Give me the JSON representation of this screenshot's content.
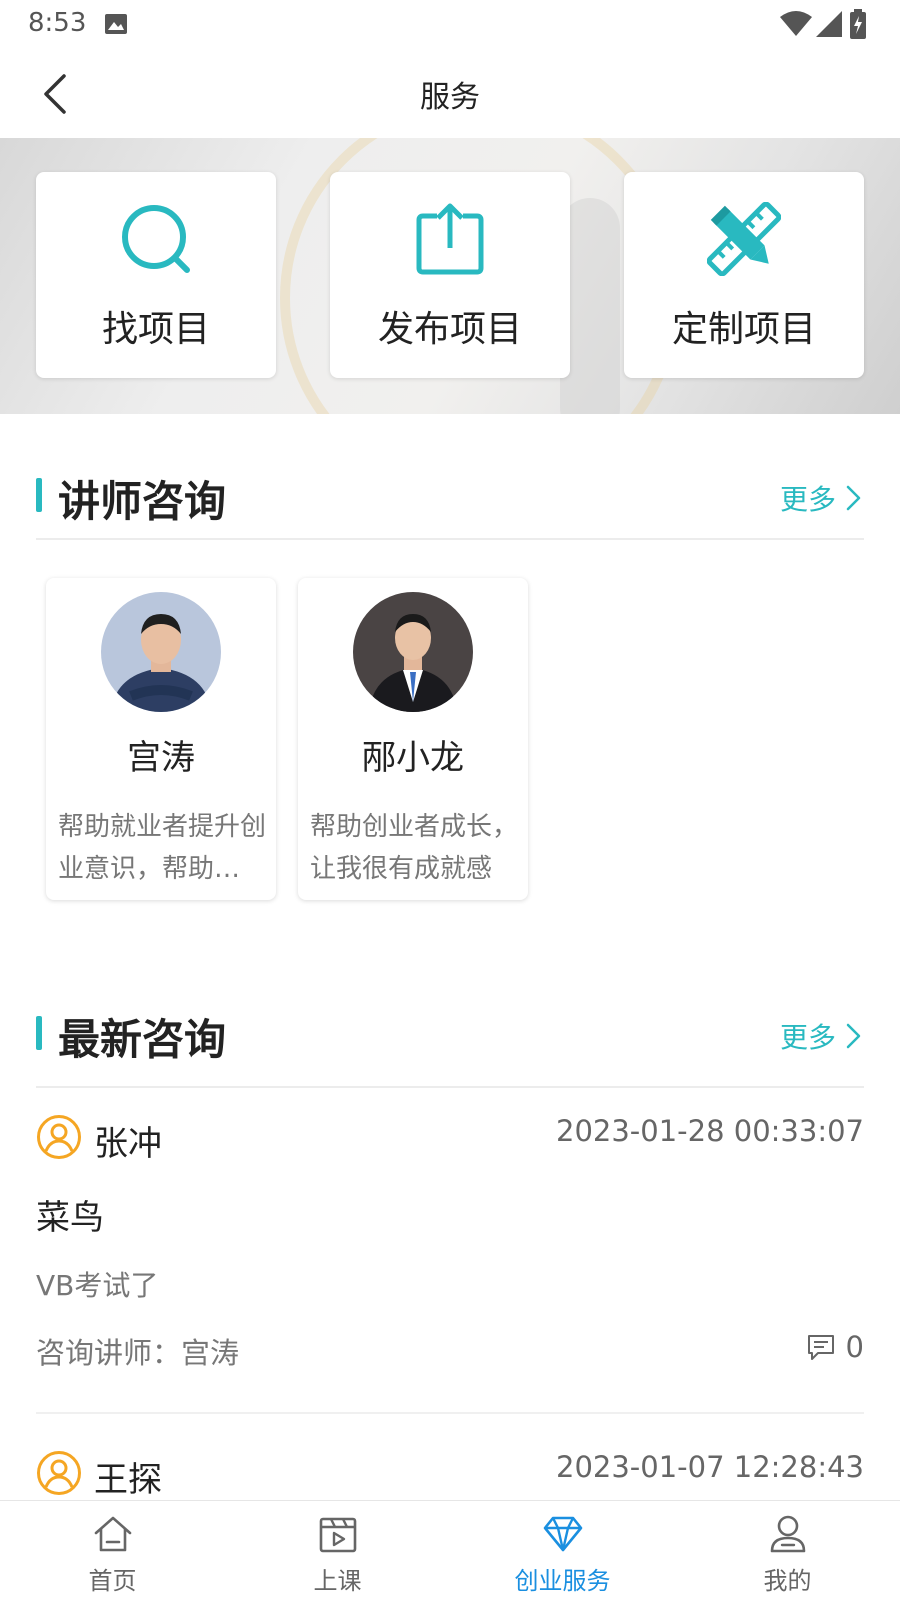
{
  "status_bar": {
    "time": "8:53"
  },
  "header": {
    "title": "服务"
  },
  "services": [
    {
      "label": "找项目",
      "icon": "search-icon"
    },
    {
      "label": "发布项目",
      "icon": "upload-icon"
    },
    {
      "label": "定制项目",
      "icon": "pencil-ruler-icon"
    }
  ],
  "instructor_section": {
    "title": "讲师咨询",
    "more": "更多",
    "instructors": [
      {
        "name": "宫涛",
        "desc": "帮助就业者提升创业意识，帮助创业者成长"
      },
      {
        "name": "邴小龙",
        "desc": "帮助创业者成长，让我很有成就感"
      }
    ]
  },
  "latest_section": {
    "title": "最新咨询",
    "more": "更多",
    "items": [
      {
        "user": "张冲",
        "time": "2023-01-28 00:33:07",
        "title": "菜鸟",
        "content": "VB考试了",
        "teacher": "咨询讲师：宫涛",
        "comments": "0"
      },
      {
        "user": "王探",
        "time": "2023-01-07 12:28:43"
      }
    ]
  },
  "tabs": [
    {
      "label": "首页",
      "icon": "home-icon"
    },
    {
      "label": "上课",
      "icon": "video-icon"
    },
    {
      "label": "创业服务",
      "icon": "diamond-icon",
      "active": true
    },
    {
      "label": "我的",
      "icon": "user-icon"
    }
  ],
  "colors": {
    "accent": "#29b9c0",
    "tab_active": "#1a8fe0",
    "user_icon": "#f5a623"
  }
}
